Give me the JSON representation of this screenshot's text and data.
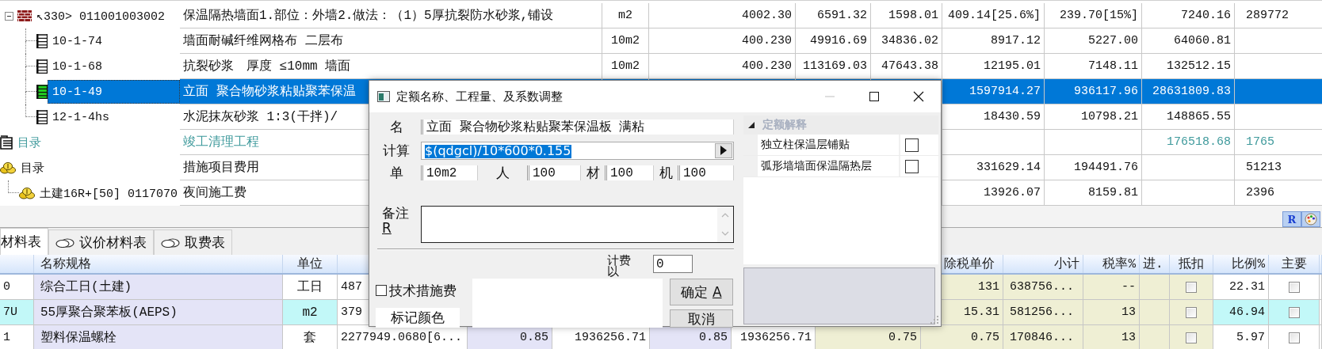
{
  "items_table": {
    "rows": [
      {
        "kind": "wall",
        "code": "↖330> 011001003002",
        "expanded": true,
        "selected": false,
        "dimmed": false,
        "name": "保温隔热墙面1.部位：外墙2.做法：（1）5厚抗裂防水砂浆,铺设",
        "unit": "m2",
        "quantity": "4002.30",
        "column_5": "6591.32",
        "column_6": "1598.01",
        "column_7": "409.14[25.6%]",
        "column_8": "239.70[15%]",
        "column_9": "7240.16",
        "column_10": "289772",
        "children": [
          {
            "kind": "quota",
            "code": "10-1-74",
            "selected": false,
            "dimmed": false,
            "name": "墙面耐碱纤维网格布 二层布",
            "unit": "10m2",
            "quantity": "400.230",
            "column_5": "49916.69",
            "column_6": "34836.02",
            "column_7": "8917.12",
            "column_8": "5227.00",
            "column_9": "64060.81"
          },
          {
            "kind": "quota",
            "code": "10-1-68",
            "selected": false,
            "dimmed": false,
            "name": "抗裂砂浆　厚度 ≤10mm 墙面",
            "unit": "10m2",
            "quantity": "400.230",
            "column_5": "113169.03",
            "column_6": "47643.38",
            "column_7": "12195.01",
            "column_8": "7148.11",
            "column_9": "132512.15"
          },
          {
            "kind": "quota",
            "code": "10-1-49",
            "selected": true,
            "dimmed": false,
            "name": "立面 聚合物砂浆粘贴聚苯保温",
            "column_7": "1597914.27",
            "column_8": "936117.96",
            "column_9": "28631809.83"
          },
          {
            "kind": "quota",
            "code": "12-1-4hs",
            "selected": false,
            "dimmed": false,
            "name": "水泥抹灰砂浆 1:3(干拌)/",
            "column_7": "18430.59",
            "column_8": "10798.21",
            "column_9": "148865.55"
          }
        ]
      },
      {
        "kind": "document",
        "code": "目录",
        "selected": false,
        "dimmed": true,
        "name": "竣工清理工程",
        "column_9": "176518.68",
        "column_10": "1765"
      },
      {
        "kind": "coin",
        "code": "目录",
        "selected": false,
        "dimmed": false,
        "name": "措施项目费用",
        "column_7": "331629.14",
        "column_8": "194491.76",
        "column_10": "51213",
        "children": [
          {
            "kind": "coin",
            "code": "土建16R+[50] 0117070",
            "selected": false,
            "dimmed": false,
            "name": "夜间施工费",
            "column_7": "13926.07",
            "column_8": "8159.81",
            "column_10": "2396"
          }
        ]
      }
    ]
  },
  "corner_button": {
    "label": "R"
  },
  "materials": {
    "tabs": [
      {
        "label": "材料表",
        "icon": false,
        "selected": true
      },
      {
        "label": "议价材料表",
        "icon": true,
        "selected": false
      },
      {
        "label": "取费表",
        "icon": true,
        "selected": false
      }
    ],
    "headers": {
      "name": "名称规格",
      "unit": "单位",
      "net_price": "除税单价",
      "subtotal": "小计",
      "tax_rate": "税率%",
      "column_13": "进.",
      "deduct": "抵扣",
      "ratio": "比例%",
      "main": "主要"
    },
    "rows": [
      {
        "selected": false,
        "code": "0",
        "name": "综合工日(土建)",
        "unit": "工日",
        "column_4": "487",
        "net_price": "131",
        "subtotal": "638756...",
        "tax_rate": "--",
        "deduct": false,
        "ratio": "22.31",
        "main": false
      },
      {
        "selected": true,
        "code": "7U",
        "name": "55厚聚合聚苯板(AEPS)",
        "unit": "m2",
        "column_4": "379",
        "net_price": "15.31",
        "subtotal": "581256...",
        "tax_rate": "13",
        "deduct": false,
        "ratio": "46.94",
        "main": false
      },
      {
        "selected": false,
        "code": "1",
        "name": "塑料保温螺栓",
        "unit": "套",
        "column_4": "2277949.0680[6...",
        "column_5": "0.85",
        "column_6": "1936256.71",
        "column_7": "0.85",
        "column_8": "1936256.71",
        "column_9": "0.75",
        "net_price": "0.75",
        "subtotal": "170846...",
        "tax_rate": "13",
        "deduct": false,
        "ratio": "5.97",
        "main": false
      }
    ]
  },
  "dialog": {
    "title": "定额名称、工程量、及系数调整",
    "name_label": "名",
    "name_value": "立面 聚合物砂浆粘贴聚苯保温板 满粘",
    "calc_label": "计算",
    "calc_value": "$(qdgcl)/10*600*0.155",
    "calc_selected": true,
    "unit_fields": [
      {
        "label": "单",
        "value": "10m2"
      },
      {
        "label": "人",
        "value": "100"
      },
      {
        "label": "材",
        "value": "100"
      },
      {
        "label": "机",
        "value": "100"
      }
    ],
    "remark_label": "备注",
    "remark_key": "R",
    "fee_label": "计费以",
    "fee_value": "0",
    "tech_checkbox": {
      "label": "技术措施费",
      "checked": false
    },
    "color_button": "标记颜色",
    "buttons": [
      {
        "label": "确定",
        "key": "A"
      },
      {
        "label": "取消"
      }
    ],
    "panel": {
      "title": "定额解释",
      "expanded": true,
      "options": [
        {
          "label": "独立柱保温层铺贴",
          "checked": false
        },
        {
          "label": "弧形墙墙面保温隔热层",
          "checked": false
        }
      ]
    }
  }
}
